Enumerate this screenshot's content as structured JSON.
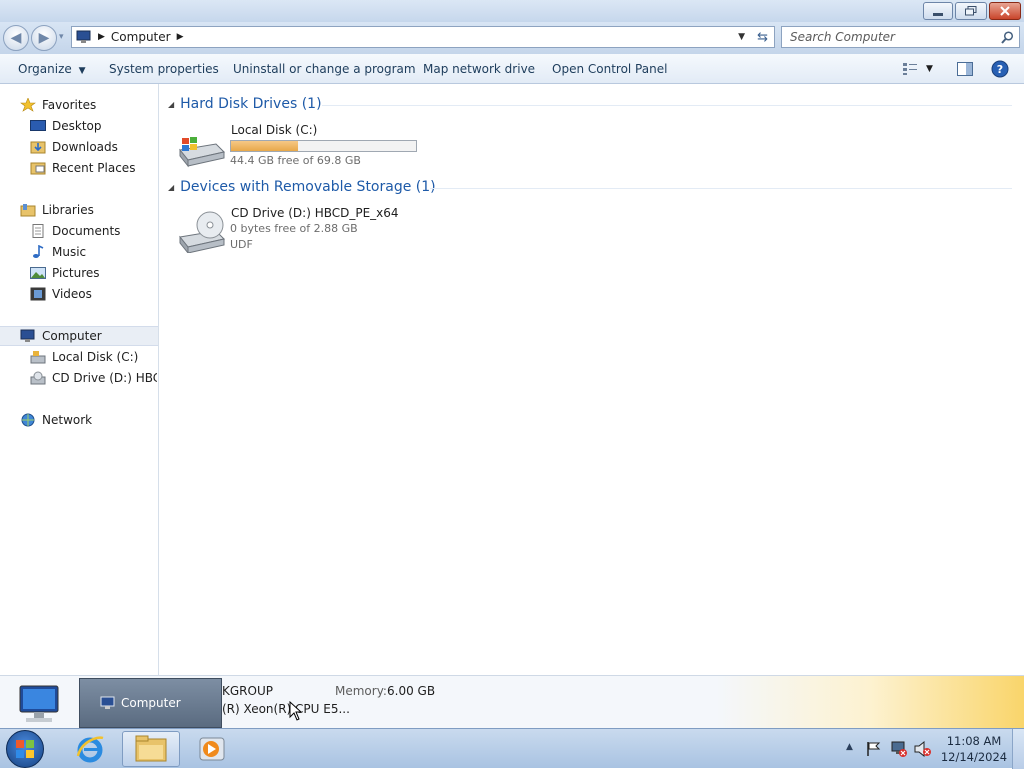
{
  "window": {
    "address": {
      "location_label": "Computer"
    },
    "search": {
      "placeholder": "Search Computer"
    }
  },
  "toolbar": {
    "organize_label": "Organize",
    "system_properties_label": "System properties",
    "uninstall_label": "Uninstall or change a program",
    "map_drive_label": "Map network drive",
    "control_panel_label": "Open Control Panel"
  },
  "nav": {
    "favorites": {
      "label": "Favorites",
      "items": [
        "Desktop",
        "Downloads",
        "Recent Places"
      ]
    },
    "libraries": {
      "label": "Libraries",
      "items": [
        "Documents",
        "Music",
        "Pictures",
        "Videos"
      ]
    },
    "computer": {
      "label": "Computer",
      "items": [
        "Local Disk (C:)",
        "CD Drive (D:) HBCD_"
      ]
    },
    "network": {
      "label": "Network"
    }
  },
  "content": {
    "hdd_group": {
      "title": "Hard Disk Drives (1)",
      "drives": [
        {
          "name": "Local Disk (C:)",
          "free_text": "44.4 GB free of 69.8 GB",
          "used_fraction": 0.364,
          "bar_color": "#e8a84a"
        }
      ]
    },
    "removable_group": {
      "title": "Devices with Removable Storage (1)",
      "drives": [
        {
          "name": "CD Drive (D:) HBCD_PE_x64",
          "free_text": "0 bytes free of 2.88 GB",
          "fs": "UDF"
        }
      ]
    }
  },
  "details": {
    "workgroup_partial": "KGROUP",
    "cpu_partial": "(R) Xeon(R) CPU E5...",
    "memory_label": "Memory:",
    "memory_value": "6.00 GB"
  },
  "tooltip": {
    "label": "Computer"
  },
  "taskbar": {
    "clock_time": "11:08 AM",
    "clock_date": "12/14/2024"
  },
  "colors": {
    "accent": "#1e5aa8",
    "taskbar": "#b4cbe6",
    "close_button": "#c9452b"
  }
}
